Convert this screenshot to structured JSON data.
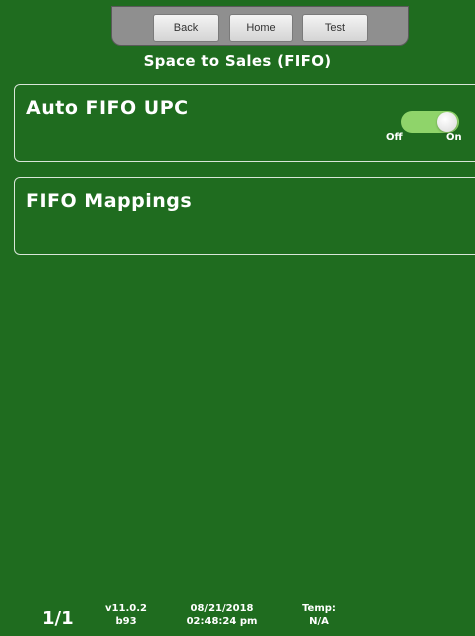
{
  "nav": {
    "back_label": "Back",
    "home_label": "Home",
    "test_label": "Test"
  },
  "page": {
    "title": "Space to Sales (FIFO)"
  },
  "settings": {
    "auto_fifo_label": "Auto FIFO UPC",
    "auto_fifo_state": "on",
    "toggle_off_label": "Off",
    "toggle_on_label": "On",
    "fifo_mappings_label": "FIFO Mappings"
  },
  "footer": {
    "page_count": "1/1",
    "version": "v11.0.2",
    "build": "b93",
    "date": "08/21/2018",
    "time": "02:48:24 pm",
    "temp_label": "Temp:",
    "temp_value": "N/A"
  },
  "colors": {
    "background": "#1f6c1f",
    "toggle_on": "#8fd46a"
  }
}
